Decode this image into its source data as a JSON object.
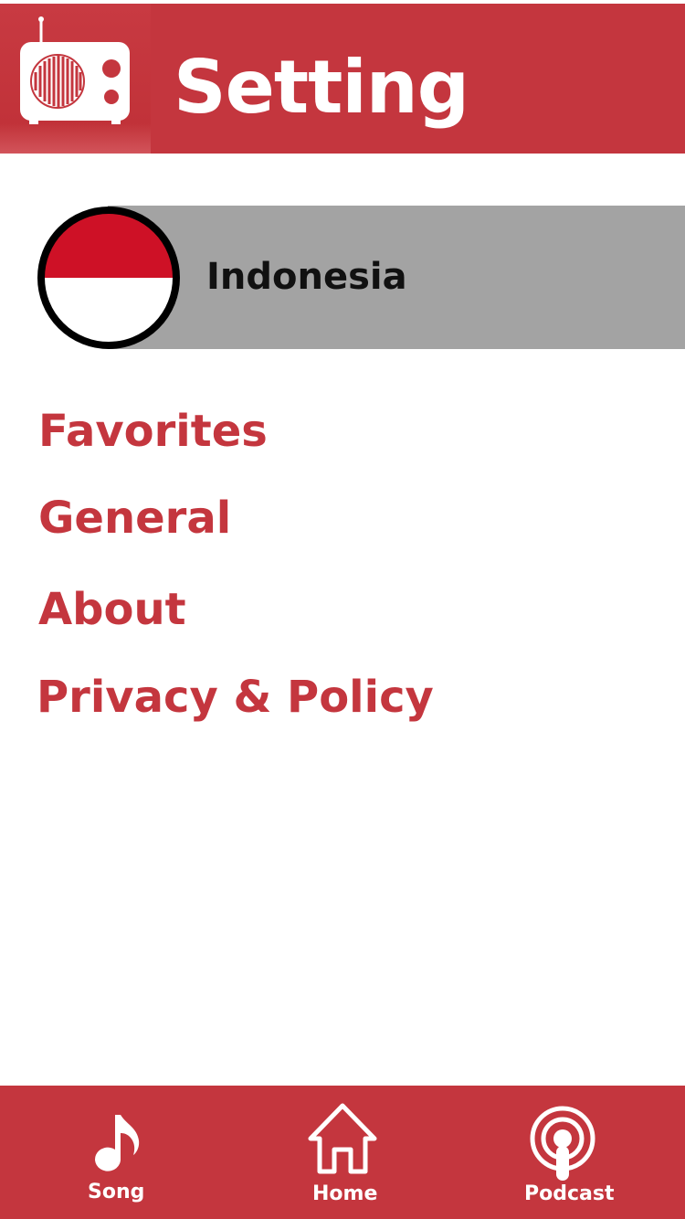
{
  "header": {
    "title": "Setting",
    "logo_icon": "radio-icon"
  },
  "country": {
    "name": "Indonesia",
    "flag_icon": "indonesia-flag-icon",
    "bar_color": "#a3a3a3"
  },
  "menu": {
    "items": [
      {
        "label": "Favorites"
      },
      {
        "label": "General"
      },
      {
        "label": "About"
      },
      {
        "label": "Privacy & Policy"
      }
    ]
  },
  "bottom_nav": {
    "items": [
      {
        "label": "Song",
        "icon": "music-note-icon"
      },
      {
        "label": "Home",
        "icon": "home-icon"
      },
      {
        "label": "Podcast",
        "icon": "podcast-icon"
      }
    ]
  },
  "colors": {
    "brand_red": "#c4363e",
    "menu_text": "#c4363e",
    "flag_red": "#ce1126",
    "flag_white": "#ffffff"
  }
}
